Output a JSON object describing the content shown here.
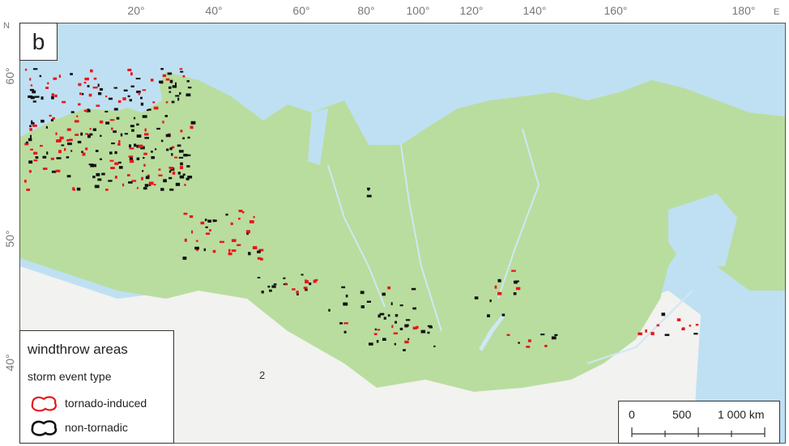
{
  "panel": {
    "letter": "b"
  },
  "axes": {
    "longitude_ticks": [
      "20°",
      "40°",
      "60°",
      "80°",
      "100°",
      "120°",
      "140°",
      "160°",
      "180°"
    ],
    "latitude_ticks": [
      "60°",
      "50°",
      "40°"
    ],
    "east_label": "E",
    "north_label": "N"
  },
  "map": {
    "region_label": "2",
    "colors": {
      "sea": "#bfe0f2",
      "land_outside": "#f2f2f0",
      "forest": "#b9dd9e",
      "river": "#cfe7f5",
      "tornado_induced": "#e8151b",
      "non_tornadic": "#111111"
    }
  },
  "legend": {
    "title": "windthrow areas",
    "subtitle": "storm event type",
    "items": [
      {
        "label": "tornado-induced",
        "icon": "red-outline-blob-icon",
        "color": "#e8151b"
      },
      {
        "label": "non-tornadic",
        "icon": "black-filled-blob-icon",
        "color": "#111111"
      }
    ]
  },
  "scalebar": {
    "labels": [
      "0",
      "500",
      "1 000 km"
    ]
  }
}
